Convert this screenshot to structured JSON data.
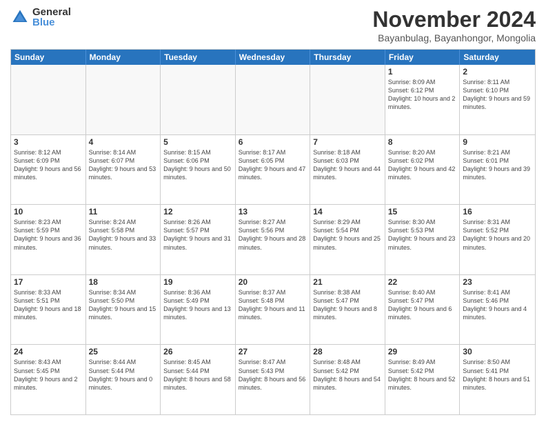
{
  "logo": {
    "general": "General",
    "blue": "Blue"
  },
  "title": "November 2024",
  "location": "Bayanbulag, Bayanhongor, Mongolia",
  "days_header": [
    "Sunday",
    "Monday",
    "Tuesday",
    "Wednesday",
    "Thursday",
    "Friday",
    "Saturday"
  ],
  "weeks": [
    [
      {
        "day": "",
        "empty": true
      },
      {
        "day": "",
        "empty": true
      },
      {
        "day": "",
        "empty": true
      },
      {
        "day": "",
        "empty": true
      },
      {
        "day": "",
        "empty": true
      },
      {
        "day": "1",
        "sunrise": "8:09 AM",
        "sunset": "6:12 PM",
        "daylight": "10 hours and 2 minutes."
      },
      {
        "day": "2",
        "sunrise": "8:11 AM",
        "sunset": "6:10 PM",
        "daylight": "9 hours and 59 minutes."
      }
    ],
    [
      {
        "day": "3",
        "sunrise": "8:12 AM",
        "sunset": "6:09 PM",
        "daylight": "9 hours and 56 minutes."
      },
      {
        "day": "4",
        "sunrise": "8:14 AM",
        "sunset": "6:07 PM",
        "daylight": "9 hours and 53 minutes."
      },
      {
        "day": "5",
        "sunrise": "8:15 AM",
        "sunset": "6:06 PM",
        "daylight": "9 hours and 50 minutes."
      },
      {
        "day": "6",
        "sunrise": "8:17 AM",
        "sunset": "6:05 PM",
        "daylight": "9 hours and 47 minutes."
      },
      {
        "day": "7",
        "sunrise": "8:18 AM",
        "sunset": "6:03 PM",
        "daylight": "9 hours and 44 minutes."
      },
      {
        "day": "8",
        "sunrise": "8:20 AM",
        "sunset": "6:02 PM",
        "daylight": "9 hours and 42 minutes."
      },
      {
        "day": "9",
        "sunrise": "8:21 AM",
        "sunset": "6:01 PM",
        "daylight": "9 hours and 39 minutes."
      }
    ],
    [
      {
        "day": "10",
        "sunrise": "8:23 AM",
        "sunset": "5:59 PM",
        "daylight": "9 hours and 36 minutes."
      },
      {
        "day": "11",
        "sunrise": "8:24 AM",
        "sunset": "5:58 PM",
        "daylight": "9 hours and 33 minutes."
      },
      {
        "day": "12",
        "sunrise": "8:26 AM",
        "sunset": "5:57 PM",
        "daylight": "9 hours and 31 minutes."
      },
      {
        "day": "13",
        "sunrise": "8:27 AM",
        "sunset": "5:56 PM",
        "daylight": "9 hours and 28 minutes."
      },
      {
        "day": "14",
        "sunrise": "8:29 AM",
        "sunset": "5:54 PM",
        "daylight": "9 hours and 25 minutes."
      },
      {
        "day": "15",
        "sunrise": "8:30 AM",
        "sunset": "5:53 PM",
        "daylight": "9 hours and 23 minutes."
      },
      {
        "day": "16",
        "sunrise": "8:31 AM",
        "sunset": "5:52 PM",
        "daylight": "9 hours and 20 minutes."
      }
    ],
    [
      {
        "day": "17",
        "sunrise": "8:33 AM",
        "sunset": "5:51 PM",
        "daylight": "9 hours and 18 minutes."
      },
      {
        "day": "18",
        "sunrise": "8:34 AM",
        "sunset": "5:50 PM",
        "daylight": "9 hours and 15 minutes."
      },
      {
        "day": "19",
        "sunrise": "8:36 AM",
        "sunset": "5:49 PM",
        "daylight": "9 hours and 13 minutes."
      },
      {
        "day": "20",
        "sunrise": "8:37 AM",
        "sunset": "5:48 PM",
        "daylight": "9 hours and 11 minutes."
      },
      {
        "day": "21",
        "sunrise": "8:38 AM",
        "sunset": "5:47 PM",
        "daylight": "9 hours and 8 minutes."
      },
      {
        "day": "22",
        "sunrise": "8:40 AM",
        "sunset": "5:47 PM",
        "daylight": "9 hours and 6 minutes."
      },
      {
        "day": "23",
        "sunrise": "8:41 AM",
        "sunset": "5:46 PM",
        "daylight": "9 hours and 4 minutes."
      }
    ],
    [
      {
        "day": "24",
        "sunrise": "8:43 AM",
        "sunset": "5:45 PM",
        "daylight": "9 hours and 2 minutes."
      },
      {
        "day": "25",
        "sunrise": "8:44 AM",
        "sunset": "5:44 PM",
        "daylight": "9 hours and 0 minutes."
      },
      {
        "day": "26",
        "sunrise": "8:45 AM",
        "sunset": "5:44 PM",
        "daylight": "8 hours and 58 minutes."
      },
      {
        "day": "27",
        "sunrise": "8:47 AM",
        "sunset": "5:43 PM",
        "daylight": "8 hours and 56 minutes."
      },
      {
        "day": "28",
        "sunrise": "8:48 AM",
        "sunset": "5:42 PM",
        "daylight": "8 hours and 54 minutes."
      },
      {
        "day": "29",
        "sunrise": "8:49 AM",
        "sunset": "5:42 PM",
        "daylight": "8 hours and 52 minutes."
      },
      {
        "day": "30",
        "sunrise": "8:50 AM",
        "sunset": "5:41 PM",
        "daylight": "8 hours and 51 minutes."
      }
    ]
  ]
}
